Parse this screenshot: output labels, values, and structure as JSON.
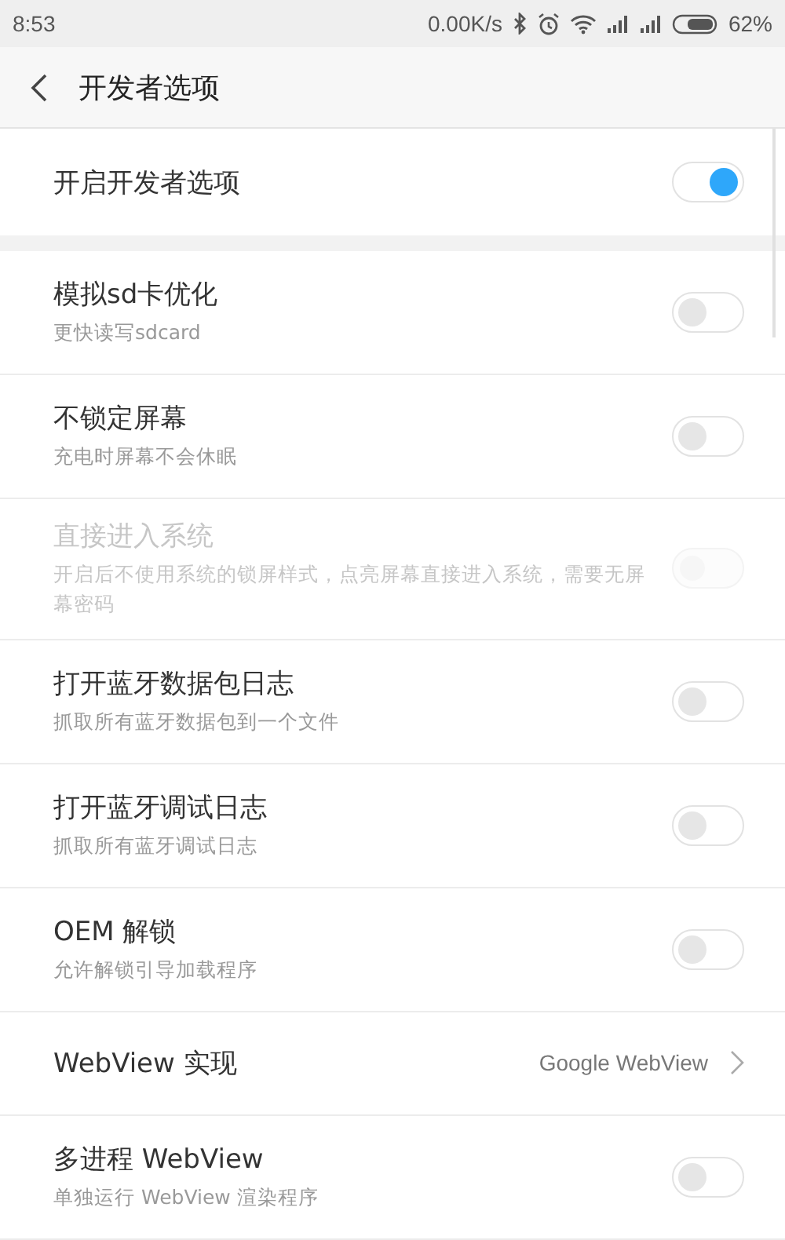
{
  "status_bar": {
    "time": "8:53",
    "net_speed": "0.00K/s",
    "battery": "62%"
  },
  "header": {
    "title": "开发者选项"
  },
  "master": {
    "title": "开启开发者选项",
    "on": true
  },
  "items": [
    {
      "kind": "toggle",
      "title": "模拟sd卡优化",
      "subtitle": "更快读写sdcard",
      "on": false,
      "disabled": false
    },
    {
      "kind": "toggle",
      "title": "不锁定屏幕",
      "subtitle": "充电时屏幕不会休眠",
      "on": false,
      "disabled": false
    },
    {
      "kind": "toggle",
      "title": "直接进入系统",
      "subtitle": "开启后不使用系统的锁屏样式，点亮屏幕直接进入系统，需要无屏幕密码",
      "on": false,
      "disabled": true
    },
    {
      "kind": "toggle",
      "title": "打开蓝牙数据包日志",
      "subtitle": "抓取所有蓝牙数据包到一个文件",
      "on": false,
      "disabled": false
    },
    {
      "kind": "toggle",
      "title": "打开蓝牙调试日志",
      "subtitle": "抓取所有蓝牙调试日志",
      "on": false,
      "disabled": false
    },
    {
      "kind": "toggle",
      "title": "OEM 解锁",
      "subtitle": "允许解锁引导加载程序",
      "on": false,
      "disabled": false
    },
    {
      "kind": "link",
      "title": "WebView 实现",
      "value": "Google WebView"
    },
    {
      "kind": "toggle",
      "title": "多进程 WebView",
      "subtitle": "单独运行 WebView 渲染程序",
      "on": false,
      "disabled": false
    }
  ]
}
